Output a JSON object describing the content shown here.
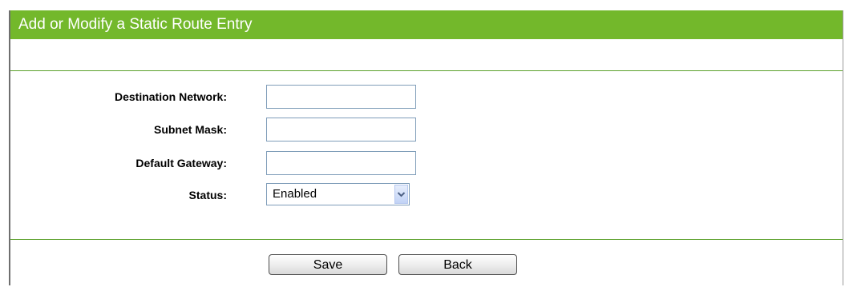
{
  "page": {
    "title": "Add or Modify a Static Route Entry",
    "colors": {
      "title_bar": "#73b82b",
      "separator": "#5aa02a",
      "input_border": "#7f9db9"
    }
  },
  "form": {
    "destination_network": {
      "label": "Destination Network:",
      "value": ""
    },
    "subnet_mask": {
      "label": "Subnet Mask:",
      "value": ""
    },
    "default_gateway": {
      "label": "Default Gateway:",
      "value": ""
    },
    "status": {
      "label": "Status:",
      "selected": "Enabled",
      "icon": "chevron-down-icon"
    }
  },
  "buttons": {
    "save": "Save",
    "back": "Back"
  }
}
